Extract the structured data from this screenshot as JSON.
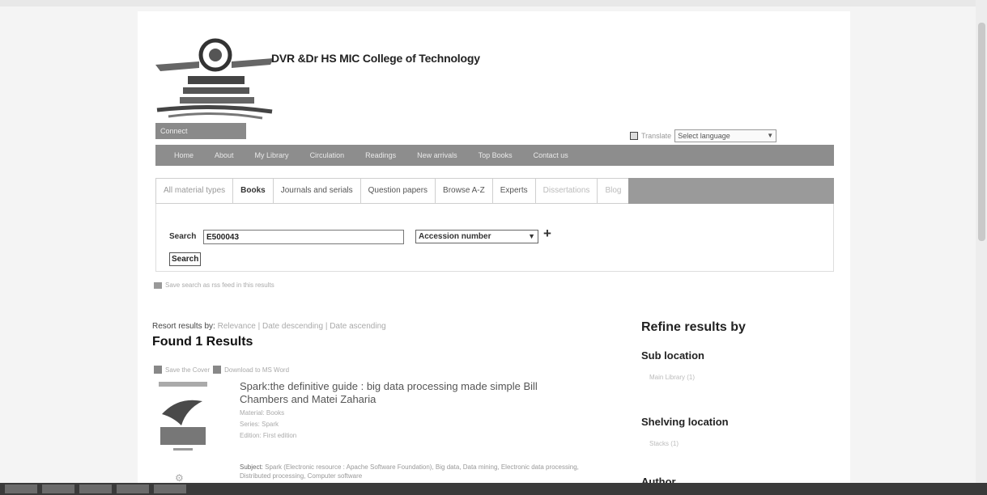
{
  "header": {
    "college_name": "DVR &Dr HS MIC College of Technology",
    "social_label": "Connect",
    "language": {
      "label": "Translate",
      "selected": "Select language"
    }
  },
  "nav": {
    "items": [
      "Home",
      "About",
      "My Library",
      "Circulation",
      "Readings",
      "New arrivals",
      "Top Books",
      "Contact us"
    ]
  },
  "search_tabs": {
    "items": [
      "All material types",
      "Books",
      "Journals and serials",
      "Question papers",
      "Browse A-Z",
      "Experts",
      "Dissertations",
      "Blog"
    ]
  },
  "search": {
    "label": "Search",
    "query": "E500043",
    "index": "Accession number",
    "add": "+",
    "button": "Search"
  },
  "saved_search": "Save search as rss feed in this results",
  "results": {
    "sort_label": "Resort results by:",
    "sort_options": "Relevance | Date descending | Date ascending",
    "found": "Found 1 Results",
    "tools": {
      "save": "Save the Cover",
      "download": "Download to MS Word"
    },
    "item": {
      "title": "Spark:the definitive guide : big data processing made simple Bill Chambers and Matei Zaharia",
      "material": "Material: Books",
      "series": "Series: Spark",
      "edition": "Edition: First edition",
      "subject_label": "Subject:",
      "subjects": "Spark (Electronic resource : Apache Software Foundation), Big data, Data mining, Electronic data processing, Distributed processing, Computer software"
    }
  },
  "refine": {
    "title": "Refine results by",
    "facets": [
      {
        "heading": "Sub location",
        "value": "Main Library (1)"
      },
      {
        "heading": "Shelving location",
        "value": "Stacks (1)"
      },
      {
        "heading": "Author",
        "value": ""
      }
    ]
  }
}
